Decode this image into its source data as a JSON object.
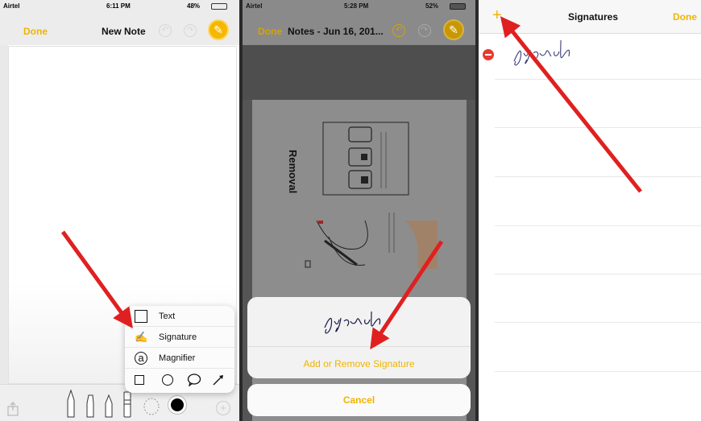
{
  "panel1": {
    "status": {
      "carrier": "Airtel",
      "time": "6:11 PM",
      "battery": "48%"
    },
    "nav": {
      "done": "Done",
      "title": "New Note"
    },
    "popup": [
      {
        "icon": "text-box-icon",
        "glyph": "T",
        "label": "Text"
      },
      {
        "icon": "signature-icon",
        "glyph": "✍",
        "label": "Signature"
      },
      {
        "icon": "magnifier-icon",
        "glyph": "a",
        "label": "Magnifier"
      }
    ],
    "shapes": [
      "square-shape-icon",
      "circle-shape-icon",
      "speech-bubble-shape-icon",
      "arrow-shape-icon"
    ]
  },
  "panel2": {
    "status": {
      "carrier": "Airtel",
      "time": "5:28 PM",
      "battery": "52%"
    },
    "nav": {
      "done": "Done",
      "title": "Notes - Jun 16, 201..."
    },
    "doc_heading": "Removal",
    "signature_text": "Signed",
    "add_remove": "Add or Remove Signature",
    "cancel": "Cancel"
  },
  "panel3": {
    "nav": {
      "add": "+",
      "title": "Signatures",
      "done": "Done"
    },
    "signature_text": "Signed"
  },
  "colors": {
    "accent": "#f0b400",
    "arrow": "#e02020",
    "delete": "#e83a2e"
  }
}
